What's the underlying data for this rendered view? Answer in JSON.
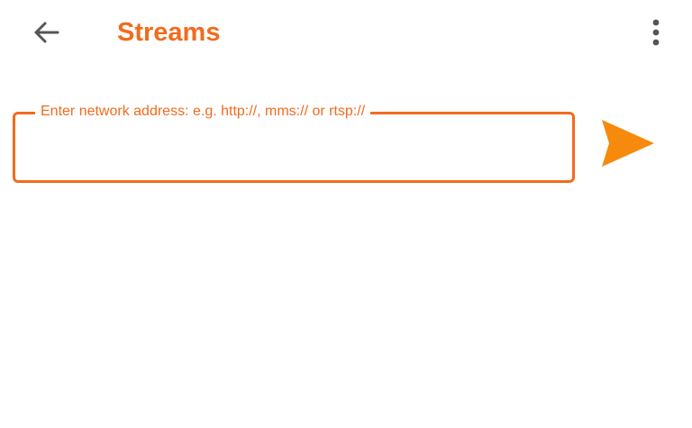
{
  "toolbar": {
    "back_icon": "arrow-left-icon",
    "title": "Streams",
    "menu_icon": "more-vertical-icon"
  },
  "address_field": {
    "label": "Enter network address: e.g. http://, mms:// or rtsp://",
    "value": "",
    "placeholder": ""
  },
  "send_button": {
    "icon": "send-icon"
  },
  "colors": {
    "accent": "#f26b1d",
    "send": "#f58a0c",
    "icon_gray": "#555555",
    "background": "#ffffff"
  }
}
